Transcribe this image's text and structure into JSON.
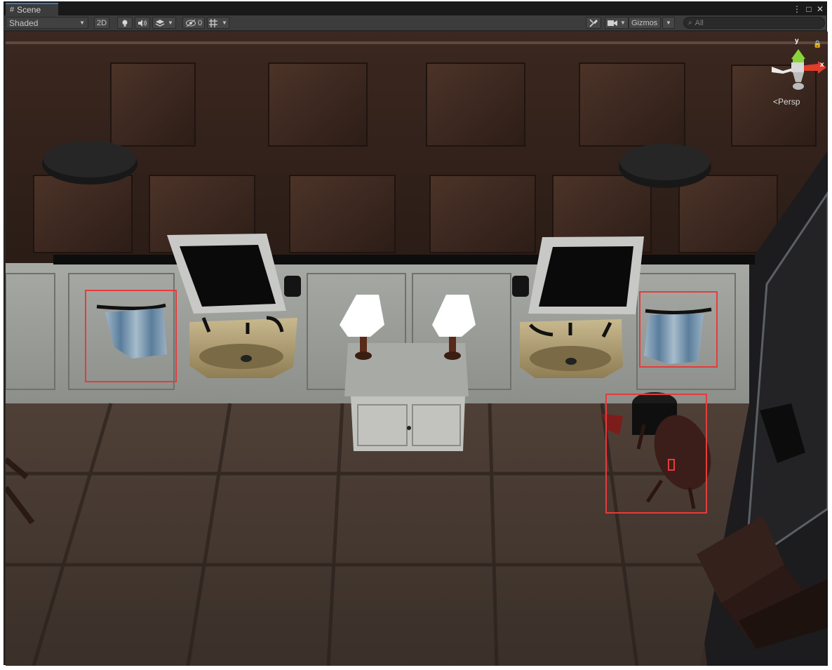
{
  "window": {
    "tab_title": "Scene",
    "controls": {
      "menu": "⋮",
      "maximize": "□",
      "close": "✕"
    }
  },
  "toolbar": {
    "draw_mode": "Shaded",
    "mode_2d": "2D",
    "hidden_count": "0",
    "gizmos_label": "Gizmos",
    "search_placeholder": "All"
  },
  "gizmo": {
    "y_label": "y",
    "x_label": "x",
    "projection_label": "Persp"
  },
  "colors": {
    "selection": "#e63b3b",
    "tab_accent": "#3a79bb",
    "axis_x": "#e23c2c",
    "axis_y": "#8bd33a"
  }
}
